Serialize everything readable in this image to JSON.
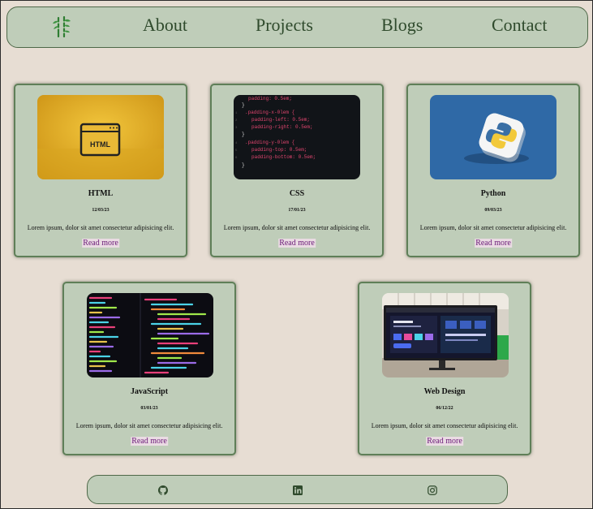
{
  "nav": {
    "logo_icon": "bamboo-icon",
    "links": [
      "About",
      "Projects",
      "Blogs",
      "Contact"
    ]
  },
  "cards": [
    {
      "title": "HTML",
      "date": "12/03/23",
      "description": "Lorem ipsum, dolor sit amet consectetur adipisicing elit.",
      "link": "Read more",
      "image": "html-window-icon-on-yellow"
    },
    {
      "title": "CSS",
      "date": "17/01/23",
      "description": "Lorem ipsum, dolor sit amet consectetur adipisicing elit.",
      "link": "Read more",
      "image": "css-code-on-dark-screen"
    },
    {
      "title": "Python",
      "date": "09/03/23",
      "description": "Lorem ipsum, dolor sit amet consectetur adipisicing elit.",
      "link": "Read more",
      "image": "python-logo-cube-on-blue"
    },
    {
      "title": "JavaScript",
      "date": "03/01/23",
      "description": "Lorem ipsum, dolor sit amet consectetur adipisicing elit.",
      "link": "Read more",
      "image": "colorful-code-on-dark-screen"
    },
    {
      "title": "Web Design",
      "date": "06/12/22",
      "description": "Lorem ipsum, dolor sit amet consectetur adipisicing elit.",
      "link": "Read more",
      "image": "monitor-showing-web-design"
    }
  ],
  "footer": {
    "icons": [
      "github-icon",
      "linkedin-icon",
      "instagram-icon"
    ]
  },
  "colors": {
    "page_background": "#e7ddd3",
    "panel_green": "#bfcdb9",
    "border_green": "#5f7f58",
    "nav_text": "#2f4a2c",
    "link_purple": "#6b1b78"
  }
}
